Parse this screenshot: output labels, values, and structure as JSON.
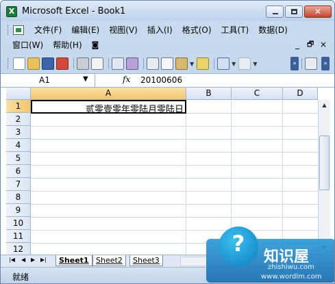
{
  "window": {
    "title": "Microsoft Excel - Book1",
    "close_glyph": "✕"
  },
  "menu": {
    "row1": [
      "文件(F)",
      "编辑(E)",
      "视图(V)",
      "插入(I)",
      "格式(O)",
      "工具(T)",
      "数据(D)"
    ],
    "row2": [
      "窗口(W)",
      "帮助(H)"
    ],
    "doc_min": "_",
    "doc_restore": "🗗",
    "doc_close": "×"
  },
  "formula_bar": {
    "name_box": "A1",
    "fx_label": "fx",
    "formula": "20100606"
  },
  "columns": [
    "A",
    "B",
    "C",
    "D"
  ],
  "rows": [
    "1",
    "2",
    "3",
    "4",
    "5",
    "6",
    "7",
    "8",
    "9",
    "10",
    "11",
    "12"
  ],
  "cells": {
    "A1": "贰零壹零年零陆月零陆日"
  },
  "sheets": [
    "Sheet1",
    "Sheet2",
    "Sheet3"
  ],
  "status": "就绪",
  "watermark": {
    "title": "知识屋",
    "sub": "zhishiwu.com",
    "url": "www.wordlm.com"
  },
  "colors": {
    "selected_header": "#f5c46b",
    "title_bar": "#bcd2ea",
    "accent": "#1a6fae"
  }
}
